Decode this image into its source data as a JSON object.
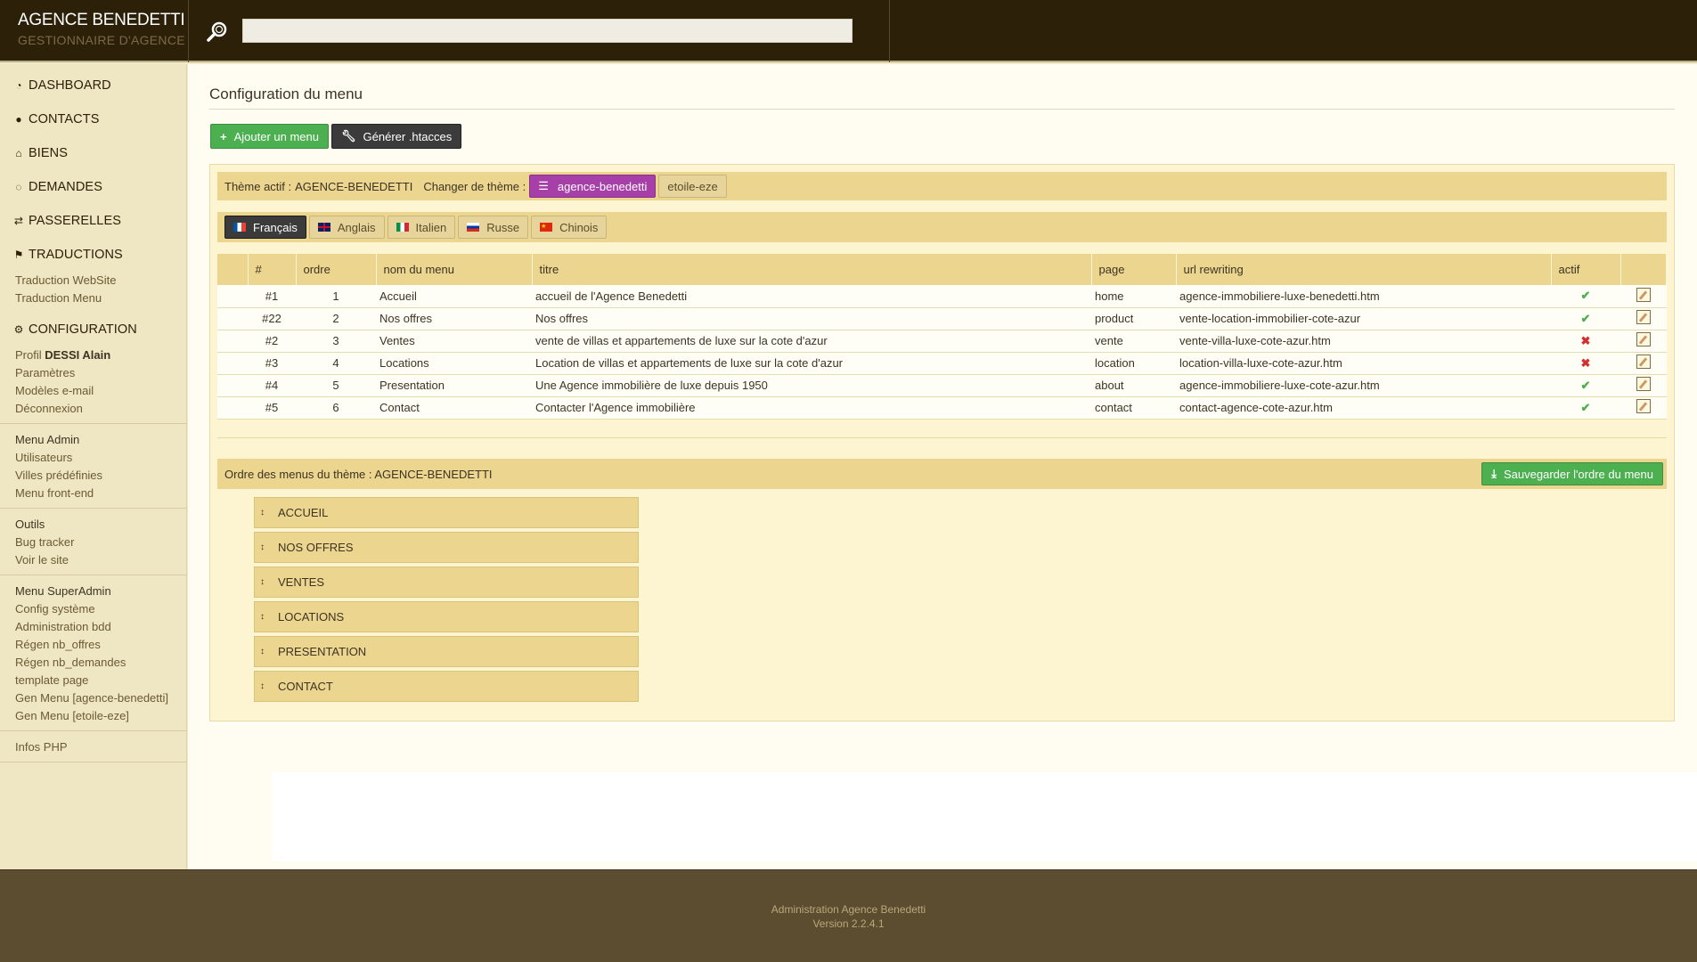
{
  "header": {
    "brand_title": "AGENCE BENEDETTI",
    "brand_subtitle": "GESTIONNAIRE D'AGENCE",
    "search_placeholder": "",
    "search_icon": "search-icon"
  },
  "sidebar": {
    "main_items": [
      {
        "label": "DASHBOARD",
        "icon": "dashboard-icon"
      },
      {
        "label": "CONTACTS",
        "icon": "user-icon"
      },
      {
        "label": "BIENS",
        "icon": "bank-icon"
      },
      {
        "label": "DEMANDES",
        "icon": "comments-icon"
      },
      {
        "label": "PASSERELLES",
        "icon": "exchange-icon"
      },
      {
        "label": "TRADUCTIONS",
        "icon": "flag-icon"
      },
      {
        "label": "CONFIGURATION",
        "icon": "cogs-icon"
      }
    ],
    "traductions_subs": [
      "Traduction WebSite",
      "Traduction Menu"
    ],
    "profil_prefix": "Profil",
    "profil_name": "DESSI Alain",
    "configuration_subs": [
      "Paramètres",
      "Modèles e-mail",
      "Déconnexion"
    ],
    "groups": [
      {
        "title": "Menu Admin",
        "items": [
          "Utilisateurs",
          "Villes prédéfinies",
          "Menu front-end"
        ]
      },
      {
        "title": "Outils",
        "items": [
          "Bug tracker",
          "Voir le site"
        ]
      },
      {
        "title": "Menu SuperAdmin",
        "items": [
          "Config système",
          "Administration bdd",
          "Régen nb_offres",
          "Régen nb_demandes",
          "template page",
          "Gen Menu [agence-benedetti]",
          "Gen Menu [etoile-eze]"
        ]
      },
      {
        "title": "",
        "items": [
          "Infos PHP"
        ]
      }
    ]
  },
  "main": {
    "page_title": "Configuration du menu",
    "add_menu_label": "Ajouter un menu",
    "generate_htaccess_label": "Générer .htacces",
    "theme_bar": {
      "active_label": "Thème actif :",
      "active_value": "AGENCE-BENEDETTI",
      "change_label": "Changer de thème :",
      "themes": [
        "agence-benedetti",
        "etoile-eze"
      ],
      "selected_theme": "agence-benedetti"
    },
    "languages": [
      "Français",
      "Anglais",
      "Italien",
      "Russe",
      "Chinois"
    ],
    "selected_language": "Français",
    "table": {
      "headers": [
        "#",
        "ordre",
        "nom du menu",
        "titre",
        "page",
        "url rewriting",
        "actif",
        ""
      ],
      "rows": [
        {
          "id": "#1",
          "ordre": "1",
          "nom": "Accueil",
          "titre": "accueil de l'Agence Benedetti",
          "page": "home",
          "url": "agence-immobiliere-luxe-benedetti.htm",
          "actif": "✔"
        },
        {
          "id": "#22",
          "ordre": "2",
          "nom": "Nos offres",
          "titre": "Nos offres",
          "page": "product",
          "url": "vente-location-immobilier-cote-azur",
          "actif": "✔"
        },
        {
          "id": "#2",
          "ordre": "3",
          "nom": "Ventes",
          "titre": "vente de villas et appartements de luxe sur la cote d'azur",
          "page": "vente",
          "url": "vente-villa-luxe-cote-azur.htm",
          "actif": "✖"
        },
        {
          "id": "#3",
          "ordre": "4",
          "nom": "Locations",
          "titre": "Location de villas et appartements de luxe sur la cote d'azur",
          "page": "location",
          "url": "location-villa-luxe-cote-azur.htm",
          "actif": "✖"
        },
        {
          "id": "#4",
          "ordre": "5",
          "nom": "Presentation",
          "titre": "Une Agence immobilière de luxe depuis 1950",
          "page": "about",
          "url": "agence-immobiliere-luxe-cote-azur.htm",
          "actif": "✔"
        },
        {
          "id": "#5",
          "ordre": "6",
          "nom": "Contact",
          "titre": "Contacter l'Agence immobilière",
          "page": "contact",
          "url": "contact-agence-cote-azur.htm",
          "actif": "✔"
        }
      ]
    },
    "order_bar": {
      "label": "Ordre des menus du thème : AGENCE-BENEDETTI",
      "save_label": "Sauvegarder l'ordre du menu"
    },
    "sort_items": [
      "ACCUEIL",
      "NOS OFFRES",
      "VENTES",
      "LOCATIONS",
      "PRESENTATION",
      "CONTACT"
    ]
  },
  "footer": {
    "line1": "Administration Agence Benedetti",
    "line2": "Version 2.2.4.1"
  },
  "colors": {
    "header_bg": "#2c2008",
    "sidebar_bg": "#efe7c3",
    "bar_bg": "#ecd58f",
    "green": "#4caf50",
    "purple": "#a63fa7",
    "footer_bg": "#5c4c30"
  }
}
